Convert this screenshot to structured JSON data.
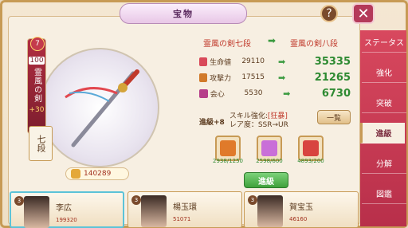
{
  "window": {
    "title": "宝物",
    "help_label": "?",
    "close_label": "✕"
  },
  "tabs": [
    "ステータス",
    "強化",
    "突破",
    "進級",
    "分解",
    "図鑑"
  ],
  "active_tab_index": 3,
  "weapon": {
    "rank_badge": "7",
    "level": "100",
    "name": "霊風の剣",
    "plus": "+30",
    "stage": "七段",
    "power": "140289"
  },
  "upgrade": {
    "from_stage": "霊風の剣七段",
    "to_stage": "霊風の剣八段",
    "arrow": "➡",
    "stats": [
      {
        "icon": "hp-icon",
        "label": "生命値",
        "from": "29110",
        "to": "35335",
        "color": "#d94a5a"
      },
      {
        "icon": "attack-icon",
        "label": "攻撃力",
        "from": "17515",
        "to": "21265",
        "color": "#d17a2a"
      },
      {
        "icon": "critical-icon",
        "label": "会心",
        "from": "5530",
        "to": "6730",
        "color": "#b63f8a"
      }
    ],
    "skill_plus": "進級+8",
    "skill_line1_prefix": "スキル強化:",
    "skill_line1_emph": "[狂暴]",
    "skill_line2": "レア度：SSR→UR",
    "list_button": "一覧",
    "upgrade_button": "進級"
  },
  "materials": [
    {
      "name": "material-scroll",
      "count": "2938/1250",
      "color": "#e07a2a"
    },
    {
      "name": "material-crystal",
      "count": "2598/600",
      "color": "#c96fd8"
    },
    {
      "name": "material-feather",
      "count": "4893/200",
      "color": "#d8443f"
    }
  ],
  "characters": [
    {
      "level": "3",
      "name": "李広",
      "power": "199320"
    },
    {
      "level": "3",
      "name": "楊玉環",
      "power": "51071"
    },
    {
      "level": "3",
      "name": "賀宝玉",
      "power": "46160"
    }
  ]
}
